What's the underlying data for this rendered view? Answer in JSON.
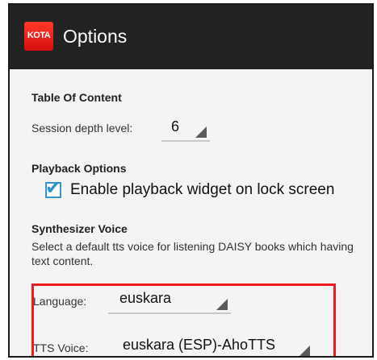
{
  "app": {
    "icon_text": "KOTA",
    "title": "Options",
    "accent_color": "#ee1c1c",
    "checkbox_color": "#2e8fd0"
  },
  "toc": {
    "header": "Table Of Content",
    "session_depth_label": "Session depth level:",
    "session_depth_value": "6"
  },
  "playback": {
    "header": "Playback Options",
    "lock_widget_checked": true,
    "lock_widget_label": "Enable playback widget on lock screen"
  },
  "synth": {
    "header": "Synthesizer Voice",
    "description": "Select a default tts voice for listening DAISY books which having text content.",
    "language_label": "Language:",
    "language_value": "euskara",
    "voice_label": "TTS Voice:",
    "voice_value": "euskara (ESP)-AhoTTS"
  }
}
